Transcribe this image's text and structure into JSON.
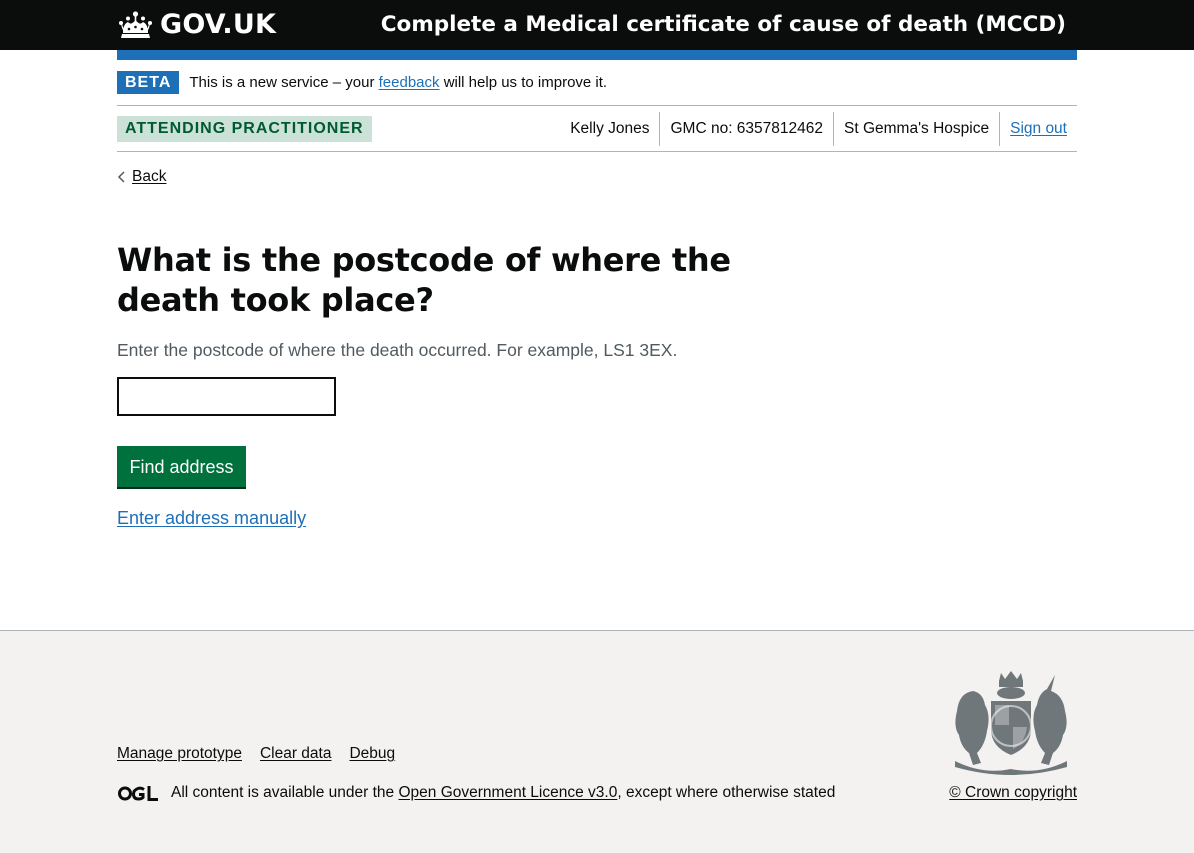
{
  "header": {
    "logo_text": "GOV.UK",
    "service_name": "Complete a Medical certificate of cause of death (MCCD)"
  },
  "phase_banner": {
    "tag": "BETA",
    "text_before": "This is a new service – your",
    "feedback_link": "feedback",
    "text_after": "will help us to improve it."
  },
  "account": {
    "role": "ATTENDING PRACTITIONER",
    "name": "Kelly Jones",
    "gmc": "GMC no: 6357812462",
    "organisation": "St Gemma's Hospice",
    "sign_out": "Sign out"
  },
  "back_link": "Back",
  "main": {
    "heading": "What is the postcode of where the death took place?",
    "hint": "Enter the postcode of where the death occurred. For example, LS1 3EX.",
    "postcode_value": "",
    "find_button": "Find address",
    "manual_link": "Enter address manually"
  },
  "footer": {
    "links": [
      "Manage prototype",
      "Clear data",
      "Debug"
    ],
    "licence_before": "All content is available under the",
    "licence_link": "Open Government Licence v3.0",
    "licence_after": ", except where otherwise stated",
    "copyright": "© Crown copyright"
  },
  "colors": {
    "header_bg": "#0b0c0c",
    "brand_blue": "#1d70b8",
    "button_green": "#00703c",
    "role_tag_bg": "#cce2d8",
    "role_tag_text": "#005a30",
    "footer_bg": "#f3f2f1"
  },
  "icons": [
    "crown-icon",
    "chevron-left-icon",
    "ogl-icon",
    "royal-coat-of-arms-icon"
  ]
}
